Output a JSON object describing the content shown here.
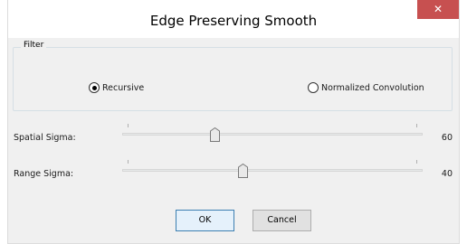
{
  "dialog": {
    "title": "Edge Preserving Smooth",
    "close_glyph": "✕"
  },
  "filter": {
    "group_label": "Filter",
    "options": [
      {
        "label": "Recursive",
        "selected": true
      },
      {
        "label": "Normalized Convolution",
        "selected": false
      }
    ]
  },
  "sliders": [
    {
      "label": "Spatial Sigma:",
      "value": "60",
      "position_fraction": 0.31
    },
    {
      "label": "Range Sigma:",
      "value": "40",
      "position_fraction": 0.4
    }
  ],
  "buttons": {
    "ok_label": "OK",
    "cancel_label": "Cancel"
  },
  "colors": {
    "close_button": "#c75050",
    "default_button_border": "#3c7fb1"
  }
}
